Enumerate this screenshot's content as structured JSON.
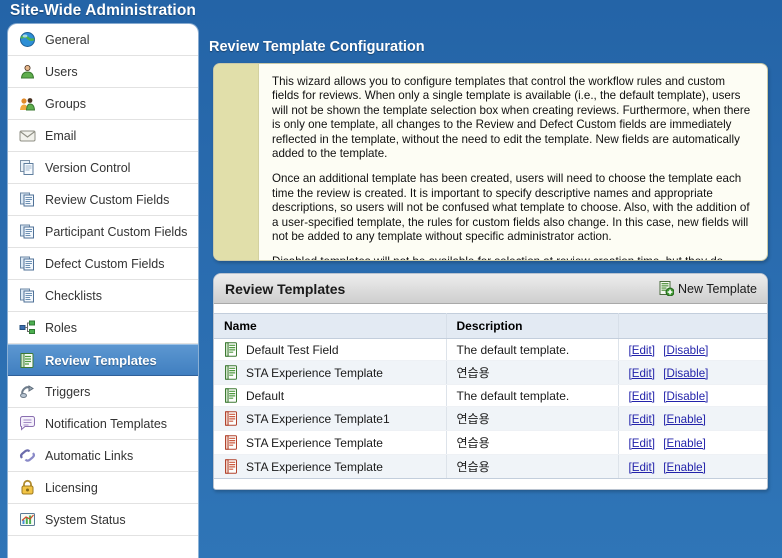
{
  "app": {
    "title": "Site-Wide Administration"
  },
  "sidebar": {
    "items": [
      {
        "label": "General",
        "icon": "globe-icon",
        "selected": false
      },
      {
        "label": "Users",
        "icon": "user-icon",
        "selected": false
      },
      {
        "label": "Groups",
        "icon": "group-icon",
        "selected": false
      },
      {
        "label": "Email",
        "icon": "envelope-icon",
        "selected": false
      },
      {
        "label": "Version Control",
        "icon": "copy-pages-icon",
        "selected": false
      },
      {
        "label": "Review Custom Fields",
        "icon": "document-fields-icon",
        "selected": false
      },
      {
        "label": "Participant Custom Fields",
        "icon": "document-fields-icon",
        "selected": false
      },
      {
        "label": "Defect Custom Fields",
        "icon": "document-fields-icon",
        "selected": false
      },
      {
        "label": "Checklists",
        "icon": "document-fields-icon",
        "selected": false
      },
      {
        "label": "Roles",
        "icon": "roles-nodes-icon",
        "selected": false
      },
      {
        "label": "Review Templates",
        "icon": "template-list-icon",
        "selected": true
      },
      {
        "label": "Triggers",
        "icon": "trigger-icon",
        "selected": false
      },
      {
        "label": "Notification Templates",
        "icon": "speech-bubble-icon",
        "selected": false
      },
      {
        "label": "Automatic Links",
        "icon": "link-icon",
        "selected": false
      },
      {
        "label": "Licensing",
        "icon": "padlock-icon",
        "selected": false
      },
      {
        "label": "System Status",
        "icon": "chart-status-icon",
        "selected": false
      }
    ]
  },
  "main": {
    "page_title": "Review Template Configuration",
    "wizard": {
      "paragraphs": [
        "This wizard allows you to configure templates that control the workflow rules and custom fields for reviews. When only a single template is available (i.e., the default template), users will not be shown the template selection box when creating reviews. Furthermore, when there is only one template, all changes to the Review and Defect Custom fields are immediately reflected in the template, without the need to edit the template. New fields are automatically added to the template.",
        "Once an additional template has been created, users will need to choose the template each time the review is created. It is important to specify descriptive names and appropriate descriptions, so users will not be confused what template to choose. Also, with the addition of a user-specified template, the rules for custom fields also change. In this case, new fields will not be added to any template without specific administrator action.",
        "Disabled templates will not be available for selection at review creation time, but they do count as a template when considering the custom field rules described above."
      ]
    },
    "panel": {
      "title": "Review Templates",
      "new_template_label": "New Template",
      "new_template_icon": "new-document-icon",
      "table": {
        "columns": [
          "Name",
          "Description",
          ""
        ],
        "rows": [
          {
            "icon": "template-enabled-icon",
            "name": "Default Test Field",
            "description": "The default template.",
            "edit": "[Edit]",
            "toggle": "[Disable]"
          },
          {
            "icon": "template-enabled-icon",
            "name": "STA Experience Template",
            "description": "연습용",
            "edit": "[Edit]",
            "toggle": "[Disable]"
          },
          {
            "icon": "template-enabled-icon",
            "name": "Default",
            "description": "The default template.",
            "edit": "[Edit]",
            "toggle": "[Disable]"
          },
          {
            "icon": "template-disabled-icon",
            "name": "STA Experience Template1",
            "description": "연습용",
            "edit": "[Edit]",
            "toggle": "[Enable]"
          },
          {
            "icon": "template-disabled-icon",
            "name": "STA Experience Template",
            "description": "연습용",
            "edit": "[Edit]",
            "toggle": "[Enable]"
          },
          {
            "icon": "template-disabled-icon",
            "name": "STA Experience Template",
            "description": "연습용",
            "edit": "[Edit]",
            "toggle": "[Enable]"
          }
        ]
      }
    }
  },
  "colors": {
    "background_blue": "#2a6caf",
    "selection_blue": "#4a89c8",
    "accent_khaki": "#e1dfaa",
    "table_header": "#e3eaf3",
    "link_blue": "#2222aa",
    "enabled_green": "#4e9a3f",
    "disabled_red": "#c0392b"
  }
}
